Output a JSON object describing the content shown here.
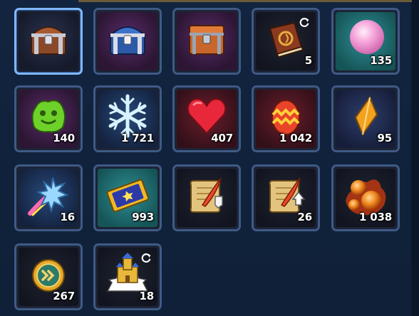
{
  "inventory": {
    "items": [
      {
        "name": "chest-brown-icon",
        "count": ""
      },
      {
        "name": "chest-blue-icon",
        "count": ""
      },
      {
        "name": "chest-orange-icon",
        "count": ""
      },
      {
        "name": "spellbook-icon",
        "count": "5"
      },
      {
        "name": "pink-orb-icon",
        "count": "135"
      },
      {
        "name": "green-slime-icon",
        "count": "140"
      },
      {
        "name": "snowflake-icon",
        "count": "1 721"
      },
      {
        "name": "heart-icon",
        "count": "407"
      },
      {
        "name": "easter-egg-icon",
        "count": "1 042"
      },
      {
        "name": "amber-crystal-icon",
        "count": "95"
      },
      {
        "name": "spiked-comet-icon",
        "count": "16"
      },
      {
        "name": "ticket-icon",
        "count": "993"
      },
      {
        "name": "scroll-quill-icon",
        "count": ""
      },
      {
        "name": "scroll-up-arrow-icon",
        "count": "26"
      },
      {
        "name": "fire-bubbles-icon",
        "count": "1 038"
      },
      {
        "name": "speed-medal-icon",
        "count": "267"
      },
      {
        "name": "castle-icon",
        "count": "18"
      }
    ]
  },
  "colors": {
    "selected_border": "#7fb7ff",
    "slot_border": "#3f5a86"
  }
}
